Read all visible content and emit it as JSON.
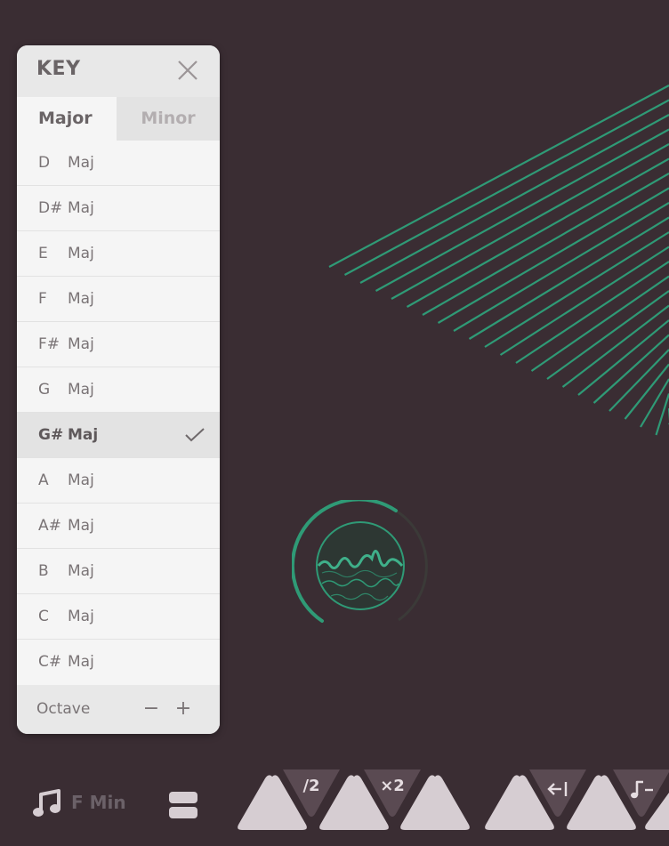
{
  "panel": {
    "title": "KEY",
    "tabs": {
      "major": "Major",
      "minor": "Minor",
      "active": "major"
    },
    "keys": [
      {
        "note": "D",
        "quality": "Maj",
        "selected": false
      },
      {
        "note": "D#",
        "quality": "Maj",
        "selected": false
      },
      {
        "note": "E",
        "quality": "Maj",
        "selected": false
      },
      {
        "note": "F",
        "quality": "Maj",
        "selected": false
      },
      {
        "note": "F#",
        "quality": "Maj",
        "selected": false
      },
      {
        "note": "G",
        "quality": "Maj",
        "selected": false
      },
      {
        "note": "G#",
        "quality": "Maj",
        "selected": true
      },
      {
        "note": "A",
        "quality": "Maj",
        "selected": false
      },
      {
        "note": "A#",
        "quality": "Maj",
        "selected": false
      },
      {
        "note": "B",
        "quality": "Maj",
        "selected": false
      },
      {
        "note": "C",
        "quality": "Maj",
        "selected": false
      },
      {
        "note": "C#",
        "quality": "Maj",
        "selected": false
      }
    ],
    "octave": {
      "label": "Octave",
      "minus": "−",
      "plus": "+"
    }
  },
  "bottom_bar": {
    "current_key": "F Min",
    "badges": {
      "half": "/2",
      "double": "×2"
    }
  },
  "colors": {
    "background": "#3a2d33",
    "accent_green": "#2f9a76",
    "pad": "#d6cdd2",
    "badge": "#5a4a52"
  },
  "icons": {
    "close": "close-icon",
    "check": "check-icon",
    "music_note": "music-note-icon",
    "layout": "layout-icon",
    "back_to_start": "back-to-start-icon",
    "note_minus": "note-minus-icon"
  }
}
